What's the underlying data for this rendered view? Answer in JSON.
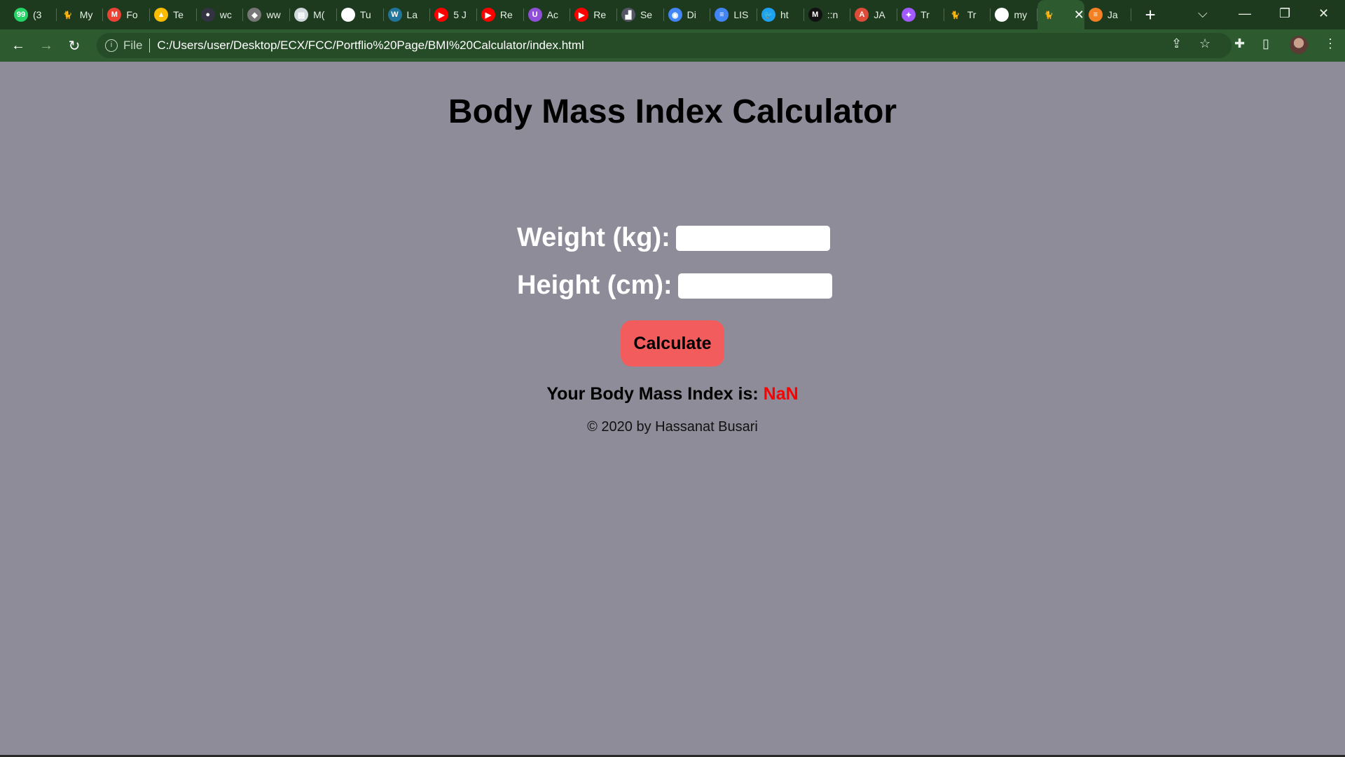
{
  "browser": {
    "tabs": [
      {
        "label": "(3",
        "icon": "whatsapp-icon",
        "color": "#25d366",
        "glyph": "99"
      },
      {
        "label": "My",
        "icon": "cat-icon",
        "color": "#1d3a1e",
        "glyph": "🐈"
      },
      {
        "label": "Fo",
        "icon": "gmail-icon",
        "color": "#ea4335",
        "glyph": "M"
      },
      {
        "label": "Te",
        "icon": "google-drive-icon",
        "color": "#fbbc04",
        "glyph": "▲"
      },
      {
        "label": "wc",
        "icon": "avatar-icon",
        "color": "#334",
        "glyph": "●"
      },
      {
        "label": "ww",
        "icon": "figma-grey-icon",
        "color": "#777",
        "glyph": "◆"
      },
      {
        "label": "M(",
        "icon": "document-icon",
        "color": "#cfd8dc",
        "glyph": "▤"
      },
      {
        "label": "Tu",
        "icon": "globe-icon",
        "color": "#fff",
        "glyph": "◍"
      },
      {
        "label": "La",
        "icon": "wordpress-icon",
        "color": "#21759b",
        "glyph": "W"
      },
      {
        "label": "5 J",
        "icon": "youtube-icon",
        "color": "#ff0000",
        "glyph": "▶"
      },
      {
        "label": "Re",
        "icon": "youtube-icon",
        "color": "#ff0000",
        "glyph": "▶"
      },
      {
        "label": "Ac",
        "icon": "udemy-icon",
        "color": "#8f4fd8",
        "glyph": "U"
      },
      {
        "label": "Re",
        "icon": "youtube-icon",
        "color": "#ff0000",
        "glyph": "▶"
      },
      {
        "label": "Se",
        "icon": "chart-icon",
        "color": "#556",
        "glyph": "▟"
      },
      {
        "label": "Di",
        "icon": "chrome-icon",
        "color": "#4285f4",
        "glyph": "◉"
      },
      {
        "label": "LIS",
        "icon": "google-docs-icon",
        "color": "#4285f4",
        "glyph": "≡"
      },
      {
        "label": "ht",
        "icon": "twitter-icon",
        "color": "#1da1f2",
        "glyph": "🐦"
      },
      {
        "label": "::n",
        "icon": "medium-icon",
        "color": "#111",
        "glyph": "M"
      },
      {
        "label": "JA",
        "icon": "angular-icon",
        "color": "#dd4b39",
        "glyph": "A"
      },
      {
        "label": "Tr",
        "icon": "figma-icon",
        "color": "#a259ff",
        "glyph": "✦"
      },
      {
        "label": "Tr",
        "icon": "cat-icon",
        "color": "#1d3a1e",
        "glyph": "🐈"
      },
      {
        "label": "my",
        "icon": "github-icon",
        "color": "#fff",
        "glyph": "●"
      },
      {
        "label": "",
        "icon": "cat-icon",
        "color": "#2d5a2f",
        "glyph": "🐈",
        "active": true
      },
      {
        "label": "Ja",
        "icon": "stackoverflow-icon",
        "color": "#f48024",
        "glyph": "≡"
      }
    ],
    "omnibox": {
      "scheme_label": "File",
      "url": "C:/Users/user/Desktop/ECX/FCC/Portflio%20Page/BMI%20Calculator/index.html"
    }
  },
  "page": {
    "title": "Body Mass Index Calculator",
    "weight_label": "Weight (kg):",
    "weight_value": "",
    "height_label": "Height (cm):",
    "height_value": "",
    "button_label": "Calculate",
    "result_label": "Your Body Mass Index is:",
    "result_value": "NaN",
    "copyright": "© 2020 by Hassanat Busari"
  }
}
